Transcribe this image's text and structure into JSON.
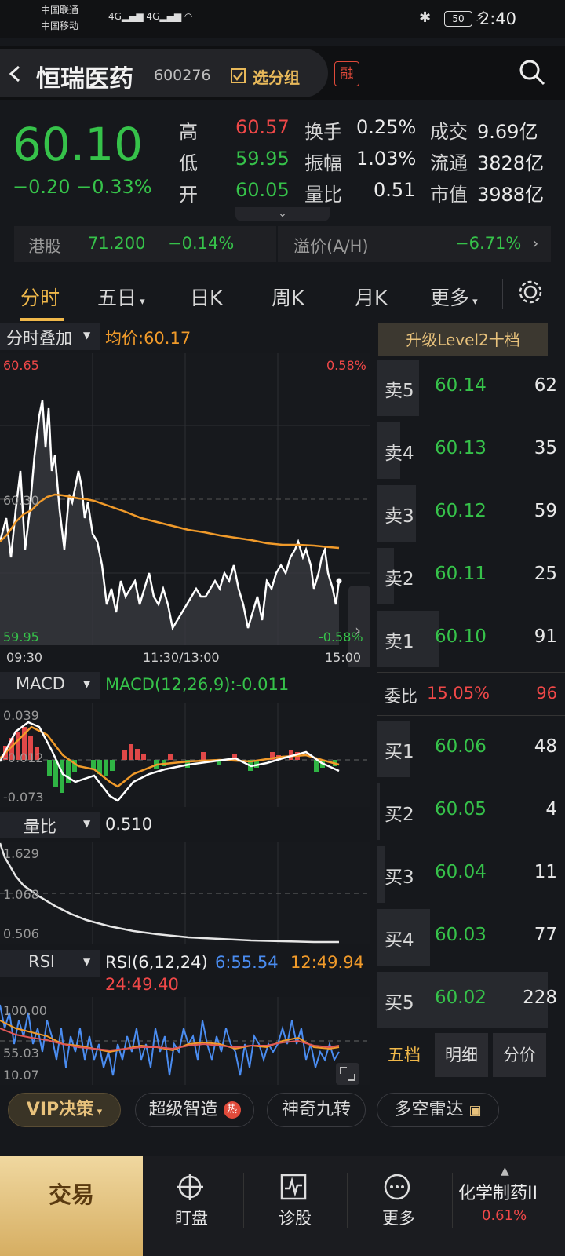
{
  "status_bar": {
    "carrier1": "中国联通",
    "carrier2": "中国移动",
    "battery": "50",
    "time": "2:40"
  },
  "header": {
    "name": "恒瑞医药",
    "code": "600276",
    "group_label": "选分组",
    "margin_badge": "融"
  },
  "quote": {
    "price": "60.10",
    "change": "−0.20",
    "change_pct": "−0.33%",
    "rows": [
      {
        "l1": "高",
        "v1": "60.57",
        "l2": "换手",
        "v2": "0.25%",
        "l3": "成交",
        "v3": "9.69亿"
      },
      {
        "l1": "低",
        "v1": "59.95",
        "l2": "振幅",
        "v2": "1.03%",
        "l3": "流通",
        "v3": "3828亿"
      },
      {
        "l1": "开",
        "v1": "60.05",
        "l2": "量比",
        "v2": "0.51",
        "l3": "市值",
        "v3": "3988亿"
      }
    ],
    "colors": {
      "up": "#f04848",
      "down": "#36c24a"
    }
  },
  "hk": {
    "label": "港股",
    "price": "71.200",
    "pct": "−0.14%",
    "premium_label": "溢价(A/H)",
    "premium": "−6.71%"
  },
  "tabs": [
    "分时",
    "五日",
    "日K",
    "周K",
    "月K",
    "更多"
  ],
  "chart": {
    "overlay_label": "分时叠加",
    "avg_label": "均价:60.17",
    "y_high": "60.65",
    "y_mid": "60.30",
    "y_low": "59.95",
    "pct_high": "0.58%",
    "pct_low": "-0.58%",
    "t_start": "09:30",
    "t_mid": "11:30/13:00",
    "t_end": "15:00",
    "macd_label": "MACD",
    "macd_value": "MACD(12,26,9):-0.011",
    "macd_top": "0.039",
    "macd_mid": "-0.012",
    "macd_low": "-0.073",
    "lb_label": "量比",
    "lb_value": "0.510",
    "lb_top": "1.629",
    "lb_mid": "1.068",
    "lb_low": "0.506",
    "rsi_label": "RSI",
    "rsi_title": "RSI(6,12,24)",
    "rsi6": "6:55.54",
    "rsi12": "12:49.94",
    "rsi24": "24:49.40",
    "rsi_top": "100.00",
    "rsi_mid": "55.03",
    "rsi_low": "10.07"
  },
  "book": {
    "level2_label": "升级Level2十档",
    "sells": [
      {
        "label": "卖5",
        "price": "60.14",
        "vol": "62"
      },
      {
        "label": "卖4",
        "price": "60.13",
        "vol": "35"
      },
      {
        "label": "卖3",
        "price": "60.12",
        "vol": "59"
      },
      {
        "label": "卖2",
        "price": "60.11",
        "vol": "25"
      },
      {
        "label": "卖1",
        "price": "60.10",
        "vol": "91"
      }
    ],
    "ratio_label": "委比",
    "ratio_pct": "15.05%",
    "ratio_vol": "96",
    "buys": [
      {
        "label": "买1",
        "price": "60.06",
        "vol": "48"
      },
      {
        "label": "买2",
        "price": "60.05",
        "vol": "4"
      },
      {
        "label": "买3",
        "price": "60.04",
        "vol": "11"
      },
      {
        "label": "买4",
        "price": "60.03",
        "vol": "77"
      },
      {
        "label": "买5",
        "price": "60.02",
        "vol": "228"
      }
    ],
    "tabs": [
      "五档",
      "明细",
      "分价"
    ]
  },
  "features": [
    "VIP决策",
    "超级智造",
    "神奇九转",
    "多空雷达"
  ],
  "hot_badge": "热",
  "bottom_nav": {
    "trade": "交易",
    "items": [
      "盯盘",
      "诊股",
      "更多"
    ],
    "sector": "化学制药II",
    "sector_pct": "0.61%"
  }
}
